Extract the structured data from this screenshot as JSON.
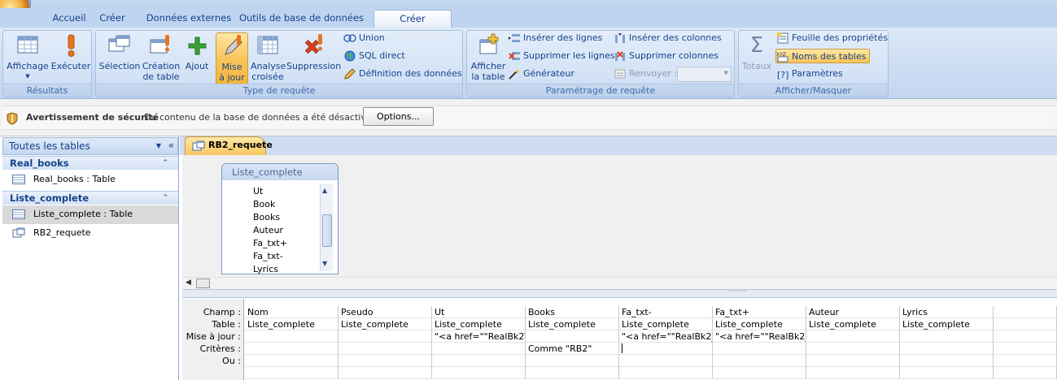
{
  "tabs": [
    "Accueil",
    "Créer",
    "Données externes",
    "Outils de base de données",
    "Créer"
  ],
  "ribbon": {
    "resultats": {
      "label": "Résultats",
      "affichage": "Affichage",
      "executer": "Exécuter"
    },
    "type_requete": {
      "label": "Type de requête",
      "selection": "Sélection",
      "creation1": "Création",
      "creation2": "de table",
      "ajout": "Ajout",
      "maj1": "Mise",
      "maj2": "à jour",
      "analyse1": "Analyse",
      "analyse2": "croisée",
      "suppression": "Suppression",
      "union": "Union",
      "sql": "SQL direct",
      "definition": "Définition des données"
    },
    "parametrage": {
      "label": "Paramétrage de requête",
      "afficher1": "Afficher",
      "afficher2": "la table",
      "inserer_lignes": "Insérer des lignes",
      "supprimer_lignes": "Supprimer les lignes",
      "generateur": "Générateur",
      "inserer_colonnes": "Insérer des colonnes",
      "supprimer_colonnes": "Supprimer colonnes",
      "renvoyer": "Renvoyer :"
    },
    "afficher_masquer": {
      "label": "Afficher/Masquer",
      "totaux": "Totaux",
      "feuille": "Feuille des propriétés",
      "noms_tables": "Noms des tables",
      "parametres": "Paramètres"
    }
  },
  "security": {
    "title": "Avertissement de sécurité",
    "message": "Du contenu de la base de données a été désactivé",
    "options": "Options..."
  },
  "nav": {
    "header": "Toutes les tables",
    "groups": [
      {
        "name": "Real_books",
        "items": [
          "Real_books : Table"
        ]
      },
      {
        "name": "Liste_complete",
        "items": [
          "Liste_complete : Table",
          "RB2_requete"
        ]
      }
    ]
  },
  "document": {
    "tab": "RB2_requete",
    "table_name": "Liste_complete",
    "fields": [
      "Ut",
      "Book",
      "Books",
      "Auteur",
      "Fa_txt+",
      "Fa_txt-",
      "Lyrics"
    ]
  },
  "grid": {
    "row_labels": [
      "Champ :",
      "Table :",
      "Mise à jour :",
      "Critères :",
      "Ou :"
    ],
    "columns": [
      {
        "champ": "Nom",
        "table": "Liste_complete",
        "maj": "",
        "criteres": ""
      },
      {
        "champ": "Pseudo",
        "table": "Liste_complete",
        "maj": "",
        "criteres": ""
      },
      {
        "champ": "Ut",
        "table": "Liste_complete",
        "maj": "\"<a href=\"\"RealBk2\\\"",
        "criteres": ""
      },
      {
        "champ": "Books",
        "table": "Liste_complete",
        "maj": "",
        "criteres": "Comme \"RB2\""
      },
      {
        "champ": "Fa_txt-",
        "table": "Liste_complete",
        "maj": "\"<a href=\"\"RealBk2_F",
        "criteres": ""
      },
      {
        "champ": "Fa_txt+",
        "table": "Liste_complete",
        "maj": "\"<a href=\"\"RealBk2_F",
        "criteres": ""
      },
      {
        "champ": "Auteur",
        "table": "Liste_complete",
        "maj": "",
        "criteres": ""
      },
      {
        "champ": "Lyrics",
        "table": "Liste_complete",
        "maj": "",
        "criteres": ""
      }
    ]
  },
  "colors": {
    "ribbon": "#d2e1f5",
    "tab_active": "#f9c660",
    "nav_selected": "#d9d9d9"
  }
}
